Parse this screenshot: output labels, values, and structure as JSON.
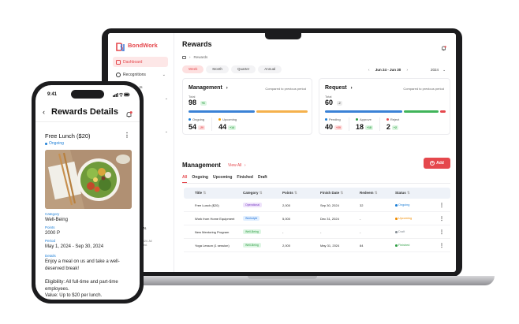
{
  "brand": {
    "name": "BondWork",
    "accent": "#e5484d"
  },
  "desktop": {
    "sidebar": {
      "items": [
        {
          "label": "Dashboard",
          "active": true
        },
        {
          "label": "Recognitions",
          "active": false
        }
      ],
      "fragments": [
        "ts",
        "nt",
        "st",
        "ia N.",
        ", 2024. All",
        "erved."
      ]
    },
    "page_title": "Rewards",
    "breadcrumb": "Rewards",
    "period_tabs": [
      "Week",
      "Month",
      "Quarter",
      "Annual"
    ],
    "active_period": "Week",
    "date_range": "Jun 24 - Jun 30",
    "year": "2024",
    "management_card": {
      "title": "Management",
      "compare_label": "Compared to previous period",
      "total_label": "Total",
      "total": "98",
      "total_delta": "+6",
      "stats": [
        {
          "label": "Ongoing",
          "value": "54",
          "delta": "-20",
          "dot": "#1c7ed6",
          "delta_kind": "neg"
        },
        {
          "label": "Upcoming",
          "value": "44",
          "delta": "+14",
          "dot": "#f59f00",
          "delta_kind": "pos"
        }
      ],
      "bar": [
        {
          "share": 0.55,
          "color": "#3b82d6"
        },
        {
          "share": 0.45,
          "color": "#f5b14c"
        }
      ]
    },
    "request_card": {
      "title": "Request",
      "compare_label": "Compared to previous period",
      "total_label": "Total",
      "total": "60",
      "total_delta": "-2",
      "stats": [
        {
          "label": "Pending",
          "value": "40",
          "delta": "+20",
          "dot": "#1c7ed6",
          "delta_kind": "neg"
        },
        {
          "label": "Approve",
          "value": "18",
          "delta": "+18",
          "dot": "#2f9e44",
          "delta_kind": "pos"
        },
        {
          "label": "Reject",
          "value": "2",
          "delta": "+2",
          "dot": "#e5484d",
          "delta_kind": "pos"
        }
      ],
      "bar": [
        {
          "share": 0.66,
          "color": "#3b82d6"
        },
        {
          "share": 0.3,
          "color": "#40b45a"
        },
        {
          "share": 0.04,
          "color": "#e5484d"
        }
      ]
    },
    "management_section": {
      "title": "Management",
      "view_all": "View All",
      "add_label": "Add",
      "tabs": [
        "All",
        "Ongoing",
        "Upcoming",
        "Finished",
        "Draft"
      ],
      "active_tab": "All"
    },
    "table": {
      "columns": [
        "Title",
        "Category",
        "Points",
        "Finish Date",
        "Redeem",
        "Status"
      ],
      "rows": [
        {
          "title": "Free Lunch ($20)",
          "category": "Operational",
          "cat_bg": "#efe3fb",
          "cat_fg": "#7b3fc4",
          "points": "2,000",
          "finish": "Sep 30, 2024",
          "redeem": "32",
          "status": "Ongoing",
          "status_color": "#1c7ed6"
        },
        {
          "title": "Work from Home Equipment",
          "category": "Workstyle",
          "cat_bg": "#e1efff",
          "cat_fg": "#1c6ed6",
          "points": "5,000",
          "finish": "Dec 31, 2024",
          "redeem": "-",
          "status": "Upcoming",
          "status_color": "#f08c00"
        },
        {
          "title": "New Mentoring Program",
          "category": "Well-Being",
          "cat_bg": "#ddf5e3",
          "cat_fg": "#2f9e44",
          "points": "-",
          "finish": "-",
          "redeem": "-",
          "status": "Draft",
          "status_color": "#868e96"
        },
        {
          "title": "Yoga Lesson (1 session)",
          "category": "Well-Being",
          "cat_bg": "#ddf5e3",
          "cat_fg": "#2f9e44",
          "points": "2,000",
          "finish": "May 31, 2024",
          "redeem": "84",
          "status": "Finished",
          "status_color": "#2f9e44"
        }
      ]
    }
  },
  "phone": {
    "time": "9:41",
    "title": "Rewards Details",
    "item_title": "Free Lunch ($20)",
    "item_status": "Ongoing",
    "category_label": "Category",
    "category": "Well-Being",
    "points_label": "Points",
    "points": "2000 P",
    "period_label": "Period",
    "period": "May 1, 2024 - Sep 30, 2024",
    "details_label": "Details",
    "details": "Enjoy a meal on us and take a well-deserved break!",
    "eligibility": "Eligibility: All full-time and part-time employees.",
    "value": "Value: Up to $20 per lunch."
  }
}
